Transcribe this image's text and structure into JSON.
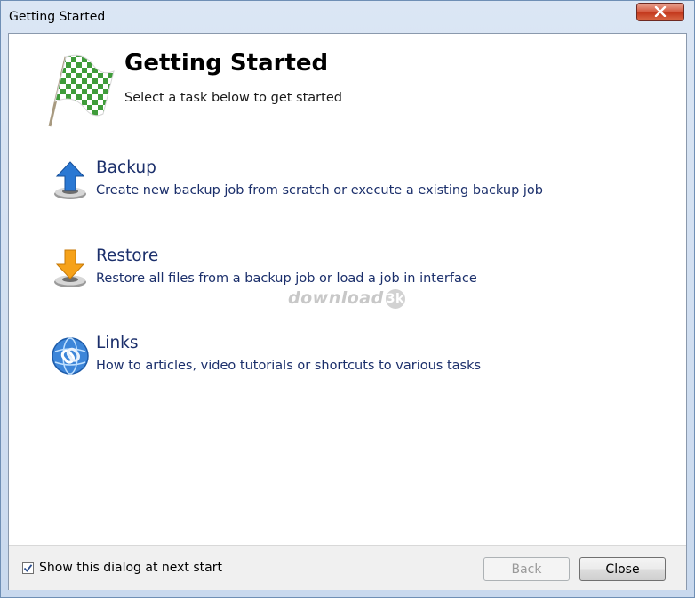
{
  "window": {
    "title": "Getting Started"
  },
  "header": {
    "title": "Getting Started",
    "subtitle": "Select a task below to get started"
  },
  "tasks": [
    {
      "name": "Backup",
      "description": "Create new backup job from scratch or execute a existing backup job"
    },
    {
      "name": "Restore",
      "description": "Restore all files from a backup job or load a job in interface"
    },
    {
      "name": "Links",
      "description": "How to articles, video tutorials or shortcuts to various tasks"
    }
  ],
  "watermark": {
    "text": "download",
    "badge": "3k"
  },
  "footer": {
    "checkbox_label": "Show this dialog at next start",
    "checkbox_checked": true,
    "back_label": "Back",
    "close_label": "Close"
  },
  "icons": {
    "header": "checkered-flag-icon",
    "backup": "backup-up-arrow-icon",
    "restore": "restore-down-arrow-icon",
    "links": "globe-link-icon",
    "close": "close-icon"
  },
  "colors": {
    "task_text": "#1b2f6b",
    "close_button": "#c2351a"
  }
}
